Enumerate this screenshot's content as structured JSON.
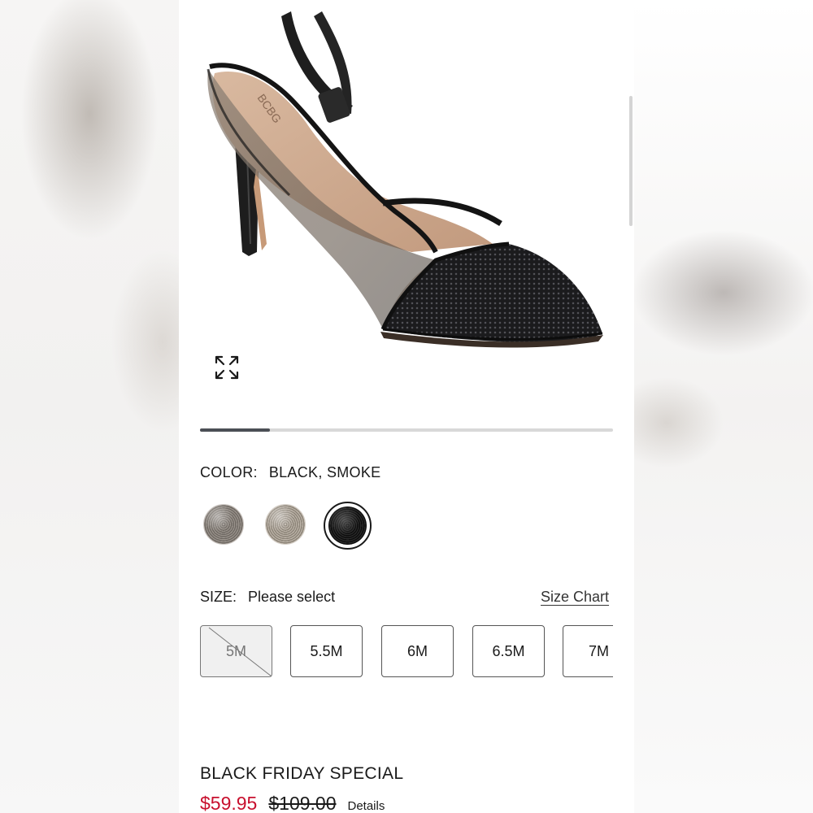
{
  "product": {
    "image_alt": "black smoke slingback pump",
    "brand_mark": "BCBG"
  },
  "icons": {
    "expand": "expand-arrows-icon"
  },
  "carousel": {
    "position_fraction": 0.17
  },
  "color": {
    "label": "COLOR:",
    "value": "BLACK, SMOKE",
    "swatches": [
      {
        "name": "pewter",
        "selected": false
      },
      {
        "name": "taupe",
        "selected": false
      },
      {
        "name": "black",
        "selected": true
      }
    ]
  },
  "size": {
    "label": "SIZE:",
    "value": "Please select",
    "chart_link": "Size Chart",
    "options": [
      {
        "label": "5M",
        "available": false
      },
      {
        "label": "5.5M",
        "available": true
      },
      {
        "label": "6M",
        "available": true
      },
      {
        "label": "6.5M",
        "available": true
      },
      {
        "label": "7M",
        "available": true
      }
    ]
  },
  "promo": {
    "title": "BLACK FRIDAY SPECIAL",
    "sale_price": "$59.95",
    "original_price": "$109.00",
    "details_link": "Details"
  },
  "colors": {
    "sale": "#c8102e",
    "text": "#1a1a1a",
    "progress": "#4b4f55"
  }
}
